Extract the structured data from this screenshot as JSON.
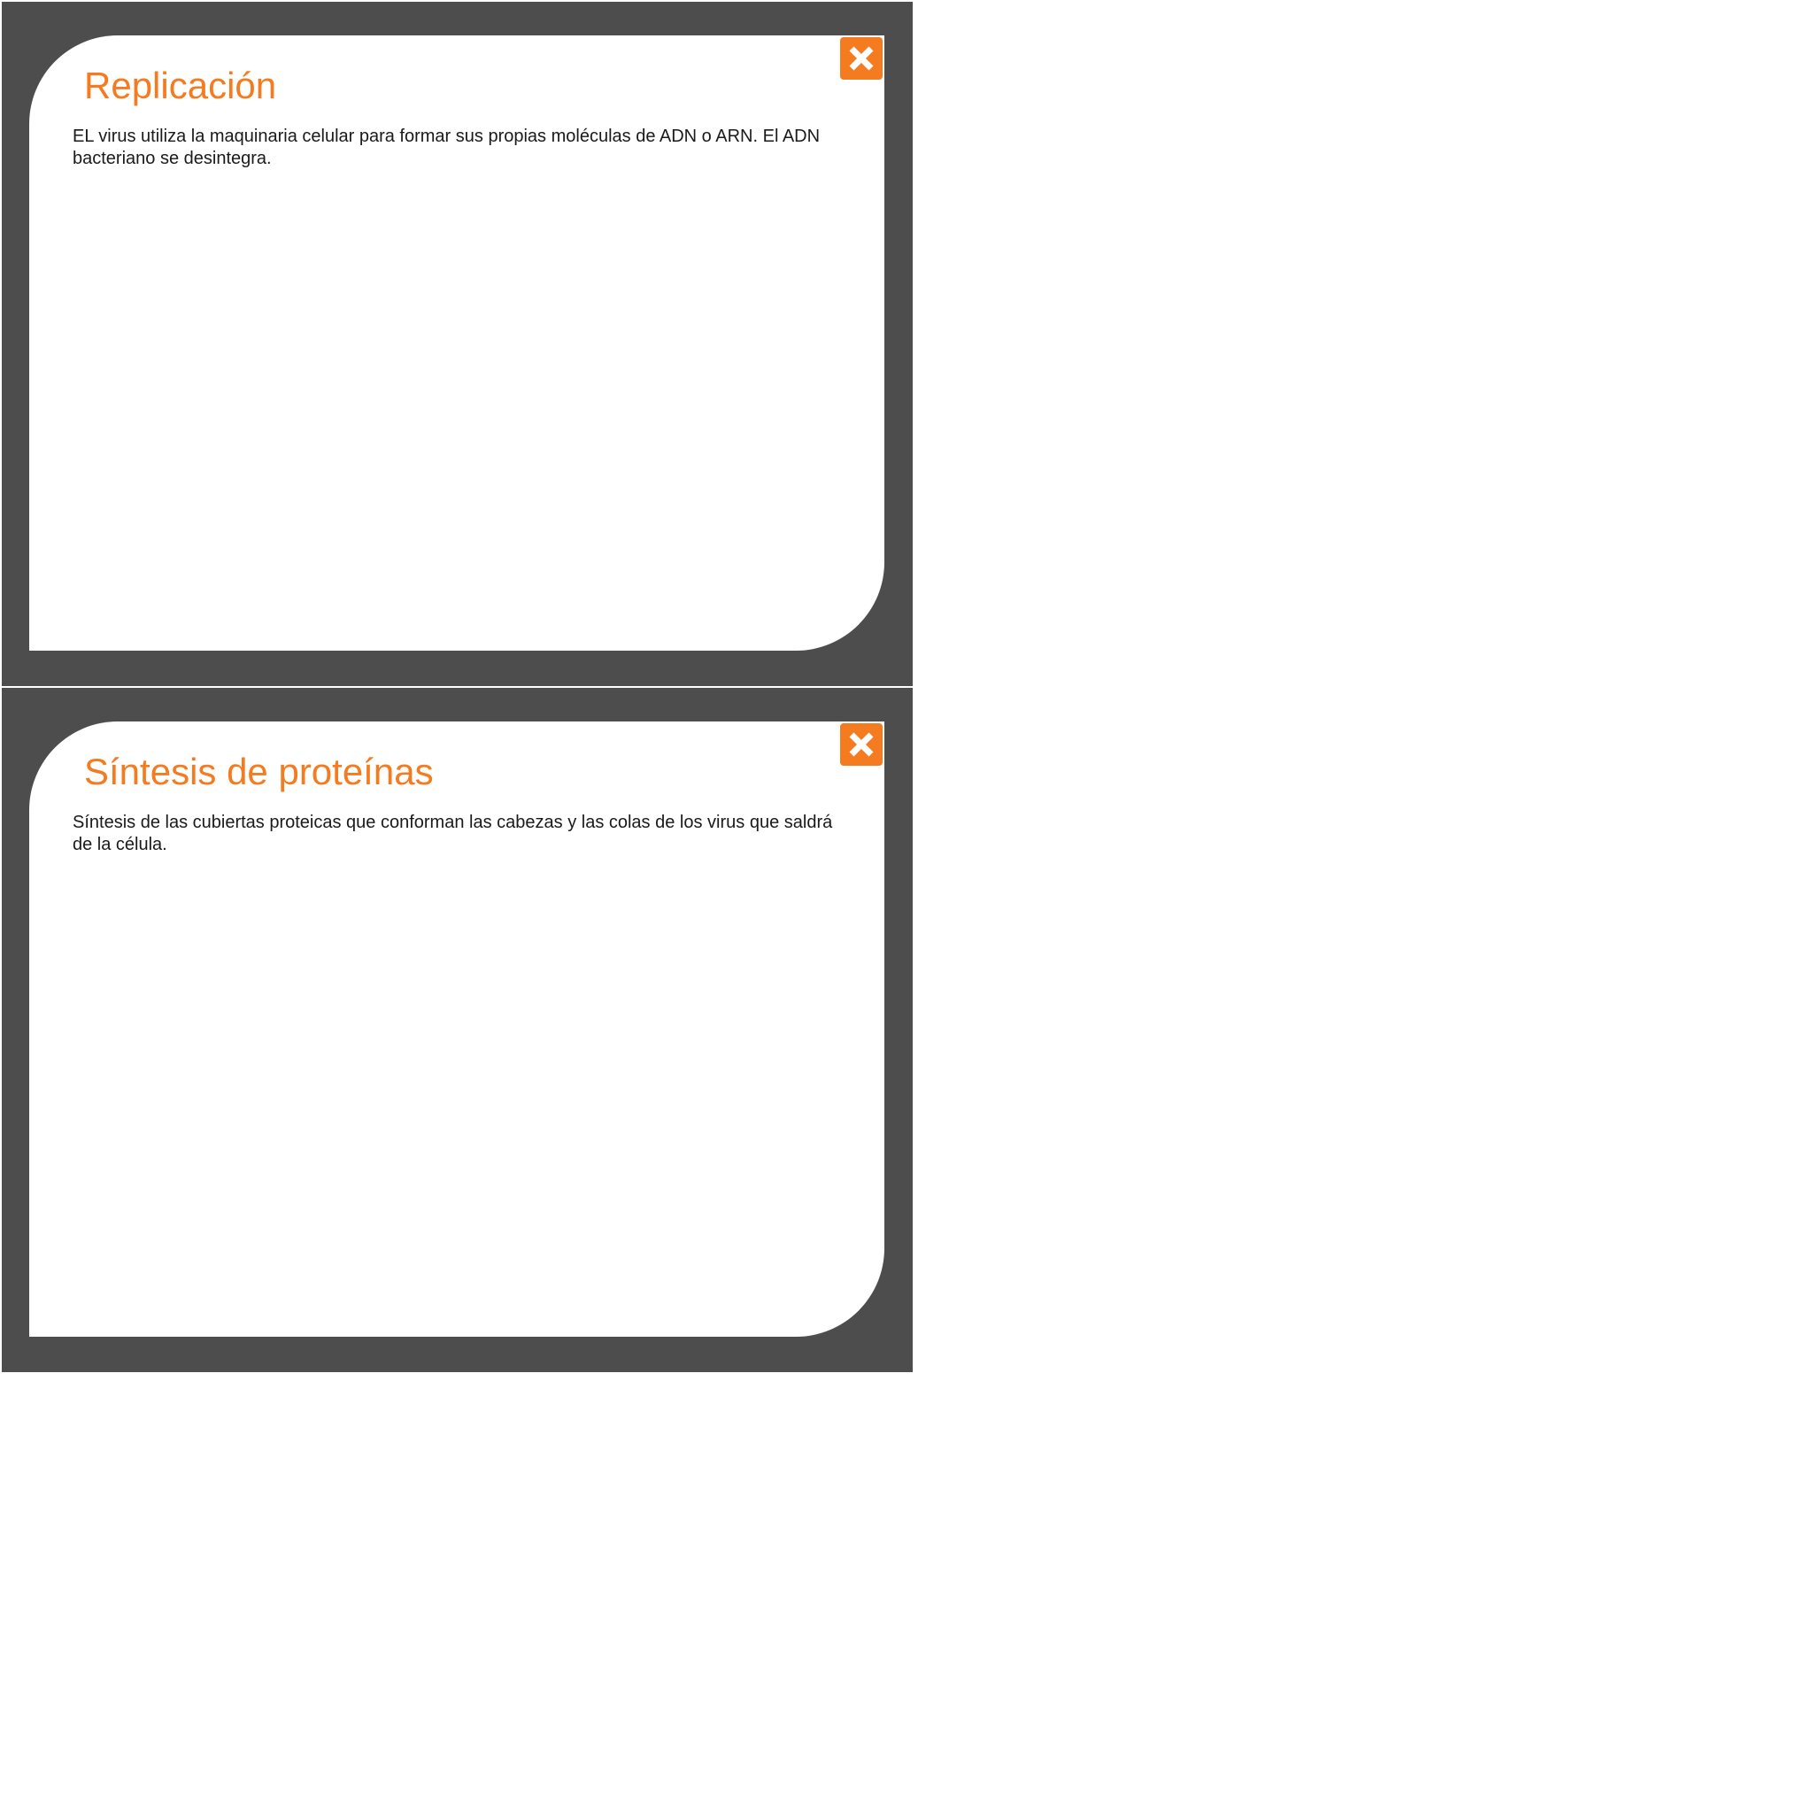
{
  "panels": [
    {
      "title": "Replicación",
      "body": "EL virus utiliza la maquinaria celular para formar sus propias moléculas de ADN o ARN. El ADN bacteriano se desintegra.",
      "close_icon": "close-icon"
    },
    {
      "title": "Síntesis de proteínas",
      "body": "Síntesis de las cubiertas proteicas que conforman las cabezas y las colas de los virus que saldrá de la célula.",
      "close_icon": "close-icon"
    }
  ],
  "colors": {
    "frame": "#4d4d4d",
    "accent": "#f47b20",
    "card": "#ffffff",
    "text": "#1a1a1a"
  }
}
